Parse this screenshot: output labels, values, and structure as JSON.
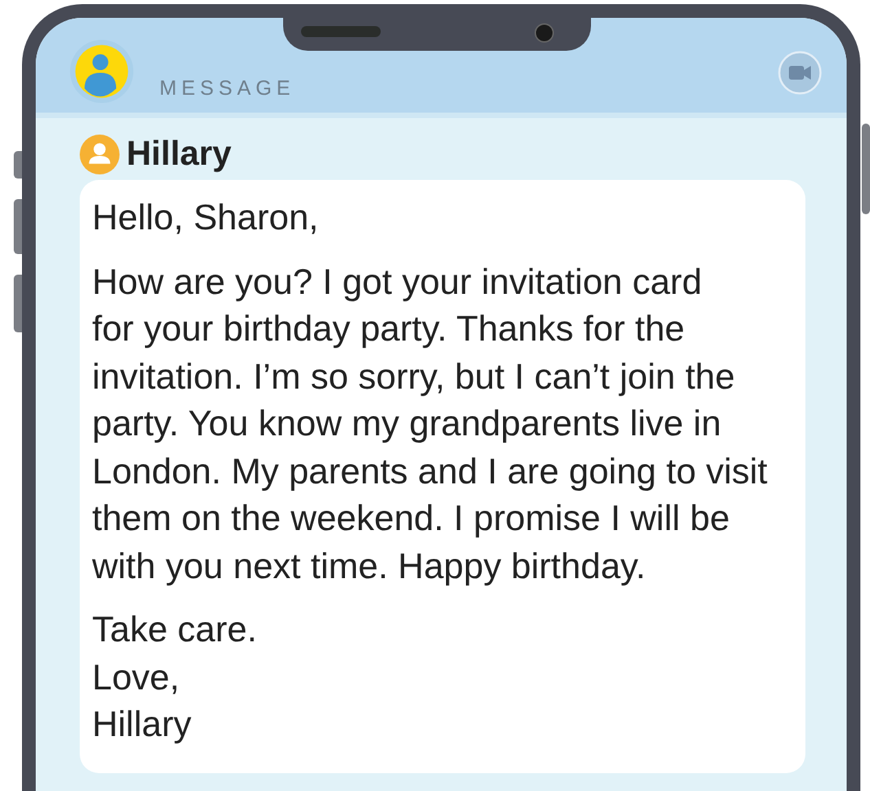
{
  "header": {
    "title": "MESSAGE"
  },
  "message": {
    "sender": "Hillary",
    "greeting": "Hello, Sharon,",
    "body_lines": [
      "How are you? I got your invitation card",
      "for your birthday party. Thanks for the",
      "invitation. I’m so sorry, but I can’t join the",
      "party. You know my grandparents live in",
      "London. My parents and I are going to visit",
      "them on the weekend. I promise I will be",
      "with you next time. Happy birthday."
    ],
    "closing": [
      "Take care.",
      "Love,",
      "Hillary"
    ]
  }
}
